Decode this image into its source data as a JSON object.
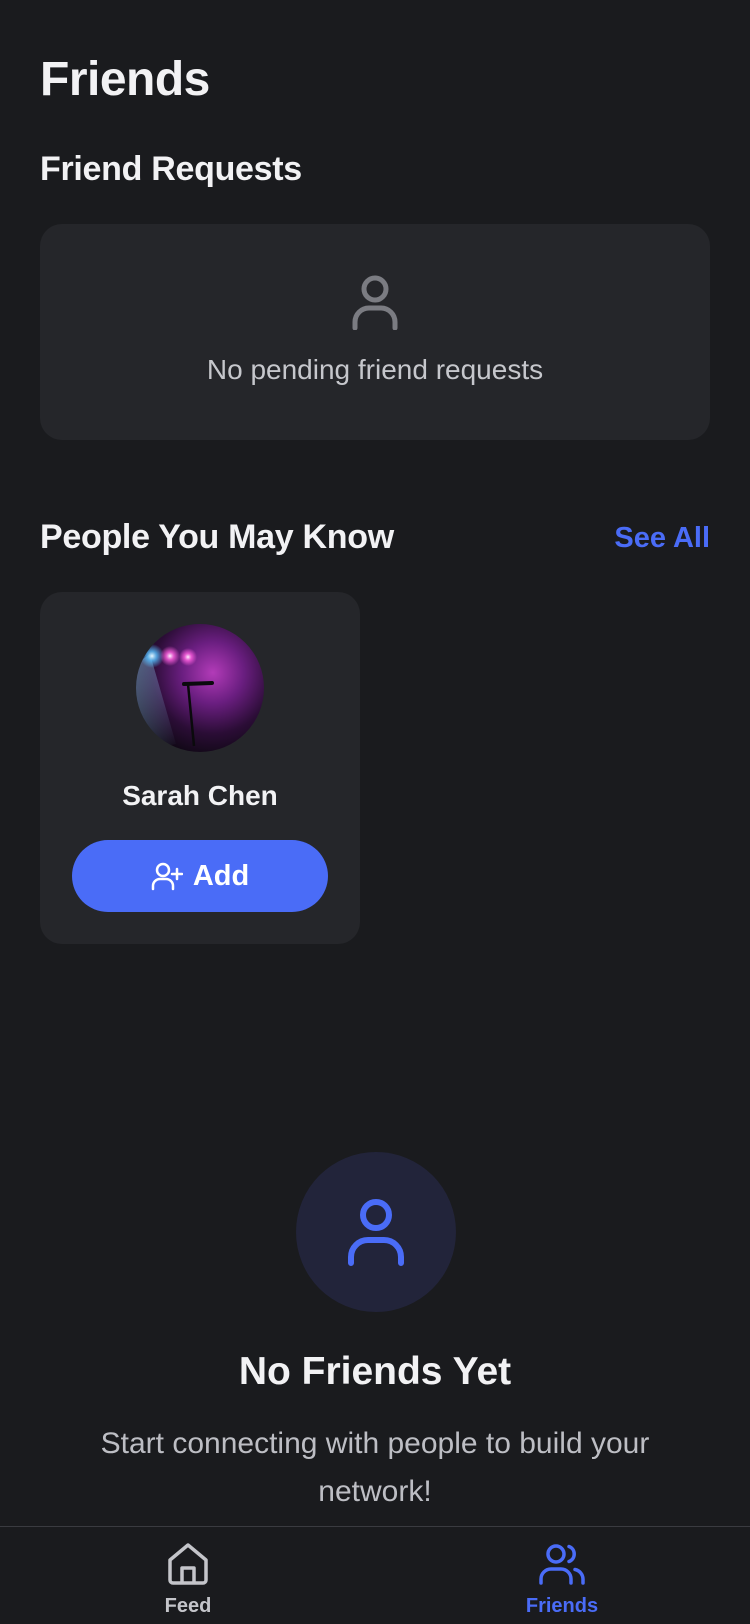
{
  "header": {
    "title": "Friends"
  },
  "friend_requests": {
    "title": "Friend Requests",
    "empty_text": "No pending friend requests",
    "icon": "user-icon"
  },
  "people_you_may_know": {
    "title": "People You May Know",
    "see_all_label": "See All",
    "people": [
      {
        "name": "Sarah Chen",
        "add_label": "Add",
        "add_icon": "user-plus-icon"
      }
    ]
  },
  "empty_state": {
    "icon": "user-icon",
    "title": "No Friends Yet",
    "subtitle": "Start connecting with people to build your network!"
  },
  "tabbar": {
    "tabs": [
      {
        "label": "Feed",
        "icon": "home-icon",
        "active": false
      },
      {
        "label": "Friends",
        "icon": "users-icon",
        "active": true
      }
    ]
  },
  "colors": {
    "background": "#1a1b1e",
    "card": "#25262a",
    "accent": "#4a6cf7",
    "text_primary": "#f2f2f4",
    "text_secondary": "#bdbec4"
  }
}
